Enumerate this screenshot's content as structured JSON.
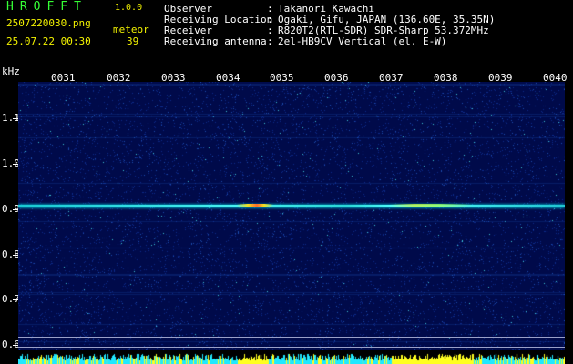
{
  "header": {
    "app_title": "HROFFT",
    "app_version": "1.0.0",
    "filename": "2507220030.png",
    "datetime": "25.07.22 00:30",
    "meteor_label": "meteor",
    "meteor_count": "39"
  },
  "metadata": [
    {
      "label": "Observer",
      "colon": ":",
      "value": "Takanori Kawachi"
    },
    {
      "label": "Receiving Location",
      "colon": ":",
      "value": "Ogaki, Gifu, JAPAN (136.60E, 35.35N)"
    },
    {
      "label": "Receiver",
      "colon": ":",
      "value": "R820T2(RTL-SDR) SDR-Sharp 53.372MHz"
    },
    {
      "label": "Receiving antenna",
      "colon": ":",
      "value": "2el-HB9CV Vertical (el. E-W)"
    }
  ],
  "axis": {
    "unit": "kHz",
    "y_labels": [
      "1.1",
      "1.0",
      "0.9",
      "0.8",
      "0.7",
      "0.6"
    ],
    "x_labels": [
      "0031",
      "0032",
      "0033",
      "0034",
      "0035",
      "0036",
      "0037",
      "0038",
      "0039",
      "0040"
    ]
  },
  "colors": {
    "title": "#f2f200",
    "text": "#ffffff",
    "count": "#35ff35",
    "background": "#000a4a",
    "signal": "#00ffff"
  }
}
